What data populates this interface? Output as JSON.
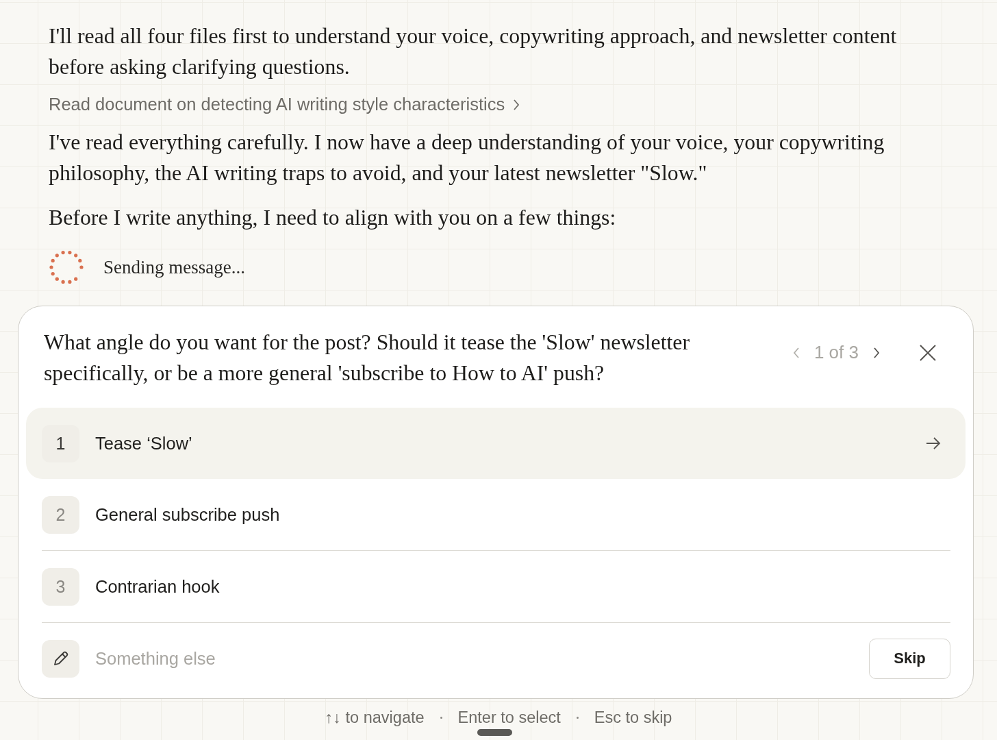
{
  "messages": [
    {
      "kind": "text",
      "text": "I'll read all four files first to understand your voice, copywriting approach, and newsletter content before asking clarifying questions."
    },
    {
      "kind": "tool",
      "text": "Read document on detecting AI writing style characteristics"
    },
    {
      "kind": "text",
      "text": "I've read everything carefully. I now have a deep understanding of your voice, your copywriting philosophy, the AI writing traps to avoid, and your latest newsletter \"Slow.\""
    },
    {
      "kind": "text",
      "text": "Before I write anything, I need to align with you on a few things:"
    },
    {
      "kind": "status",
      "text": "Sending message..."
    }
  ],
  "question": {
    "text": "What angle do you want for the post? Should it tease the 'Slow' newsletter specifically, or be a more general 'subscribe to How to AI' push?",
    "pager": "1 of 3",
    "options": [
      {
        "number": "1",
        "label": "Tease ‘Slow’",
        "selected": true
      },
      {
        "number": "2",
        "label": "General subscribe push",
        "selected": false
      },
      {
        "number": "3",
        "label": "Contrarian hook",
        "selected": false
      }
    ],
    "other": {
      "placeholder": "Something else"
    },
    "skip": "Skip"
  },
  "hints": [
    "↑↓ to navigate",
    "Enter to select",
    "Esc to skip"
  ]
}
